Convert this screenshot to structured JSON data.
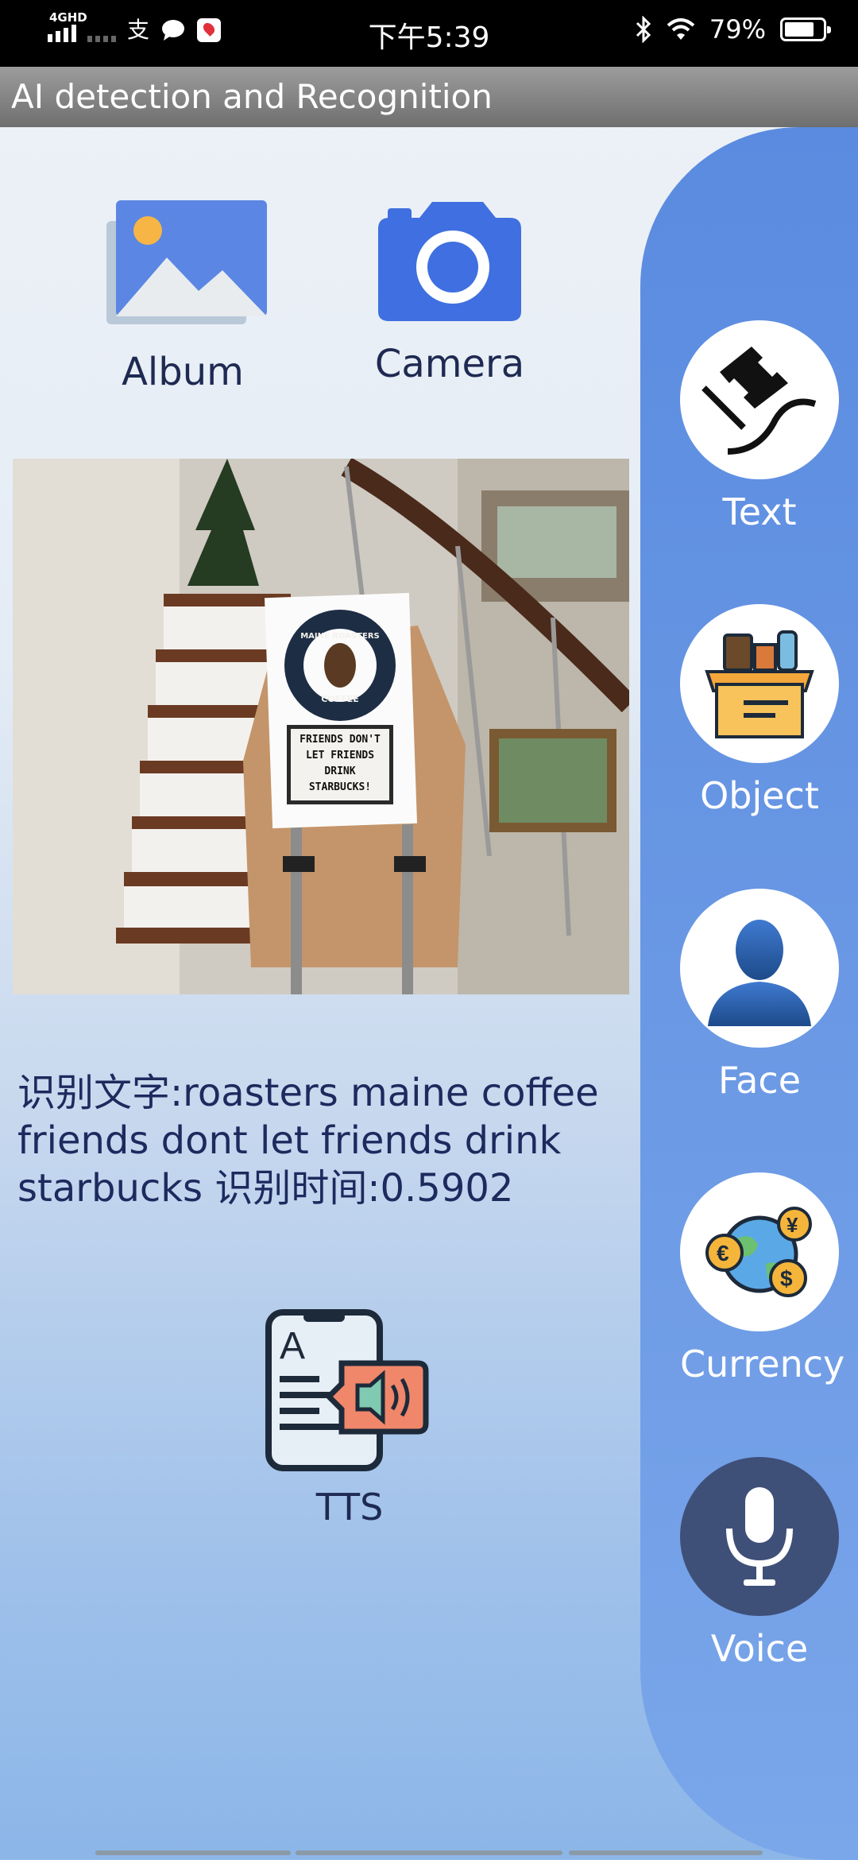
{
  "status_bar": {
    "network": "4GHD",
    "time": "下午5:39",
    "battery_percent_label": "79%",
    "battery_level": 0.79,
    "icons": [
      "signal-icon",
      "signal-weak-icon",
      "alipay-icon",
      "message-icon",
      "map-icon",
      "bluetooth-icon",
      "wifi-icon",
      "battery-icon"
    ]
  },
  "app": {
    "title": "AI detection and Recognition"
  },
  "actions": {
    "album_label": "Album",
    "camera_label": "Camera"
  },
  "photo": {
    "sign_title": "MAINE ROASTERS",
    "sign_subtitle": "COFFEE",
    "sign_message_lines": [
      "FRIENDS DON'T",
      "LET FRIENDS",
      "DRINK",
      "STARBUCKS!"
    ]
  },
  "result": {
    "text": "识别文字:roasters maine coffee friends dont let friends drink starbucks 识别时间:0.5902"
  },
  "tts": {
    "label": "TTS"
  },
  "sidebar": {
    "items": [
      {
        "label": "Text",
        "icon": "text-icon"
      },
      {
        "label": "Object",
        "icon": "object-box-icon"
      },
      {
        "label": "Face",
        "icon": "face-icon"
      },
      {
        "label": "Currency",
        "icon": "currency-icon"
      },
      {
        "label": "Voice",
        "icon": "microphone-icon"
      }
    ]
  },
  "colors": {
    "accent_blue": "#5a8be0",
    "camera_blue": "#3f6fe0",
    "text_dark": "#1e2a52"
  }
}
